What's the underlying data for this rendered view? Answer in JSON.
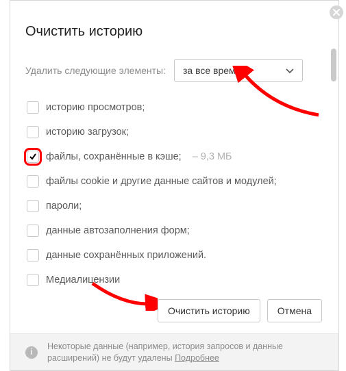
{
  "title": "Очистить историю",
  "deleteLabel": "Удалить следующие элементы:",
  "select": {
    "value": "за все время"
  },
  "items": [
    {
      "label": "историю просмотров;",
      "checked": false,
      "size": null
    },
    {
      "label": "историю загрузок;",
      "checked": false,
      "size": null
    },
    {
      "label": "файлы, сохранённые в кэше;",
      "checked": true,
      "size": "9,3 МБ",
      "highlighted": true
    },
    {
      "label": "файлы cookie и другие данные сайтов и модулей;",
      "checked": false,
      "size": null
    },
    {
      "label": "пароли;",
      "checked": false,
      "size": null
    },
    {
      "label": "данные автозаполнения форм;",
      "checked": false,
      "size": null
    },
    {
      "label": "данные сохранённых приложений.",
      "checked": false,
      "size": null
    },
    {
      "label": "Медиалицензии",
      "checked": false,
      "size": null
    }
  ],
  "buttons": {
    "clear": "Очистить историю",
    "cancel": "Отмена"
  },
  "footer": {
    "text": "Некоторые данные (например, история запросов и данные расширений) не будут удалены ",
    "more": "Подробнее"
  }
}
